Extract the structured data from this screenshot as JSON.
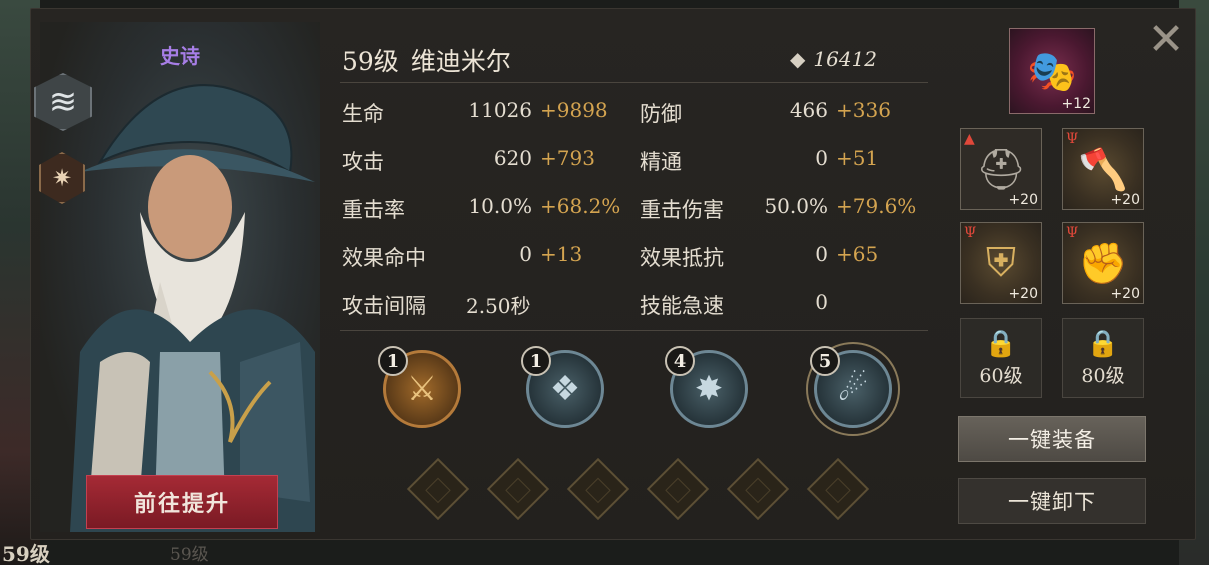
{
  "hero": {
    "rarity": "史诗",
    "level_text": "59级",
    "name": "维迪米尔",
    "power": "16412",
    "upgrade_button": "前往提升"
  },
  "stats": [
    {
      "label": "生命",
      "base": "11026",
      "bonus": "+9898"
    },
    {
      "label": "防御",
      "base": "466",
      "bonus": "+336"
    },
    {
      "label": "攻击",
      "base": "620",
      "bonus": "+793"
    },
    {
      "label": "精通",
      "base": "0",
      "bonus": "+51"
    },
    {
      "label": "重击率",
      "base": "10.0%",
      "bonus": "+68.2%"
    },
    {
      "label": "重击伤害",
      "base": "50.0%",
      "bonus": "+79.6%"
    },
    {
      "label": "效果命中",
      "base": "0",
      "bonus": "+13"
    },
    {
      "label": "效果抵抗",
      "base": "0",
      "bonus": "+65"
    },
    {
      "label": "攻击间隔",
      "base": "2.50秒",
      "bonus": ""
    },
    {
      "label": "技能急速",
      "base": "0",
      "bonus": ""
    }
  ],
  "skills": [
    {
      "level": "1",
      "icon": "crossed-swords-icon"
    },
    {
      "level": "1",
      "icon": "crystal-shards-icon"
    },
    {
      "level": "4",
      "icon": "spiked-burst-icon"
    },
    {
      "level": "5",
      "icon": "comet-orb-icon"
    }
  ],
  "equipment": {
    "mask_plus": "+12",
    "helmet_plus": "+20",
    "weapon_plus": "+20",
    "armor_plus": "+20",
    "gloves_plus": "+20",
    "locked_slot_1": "60级",
    "locked_slot_2": "80级"
  },
  "actions": {
    "equip_all": "一键装备",
    "unequip_all": "一键卸下"
  },
  "background": {
    "bottom_left_level": "59级",
    "bottom_faded_level": "59级"
  }
}
